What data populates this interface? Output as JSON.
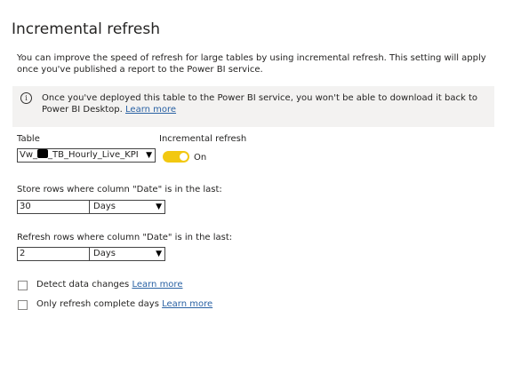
{
  "title": "Incremental refresh",
  "intro": "You can improve the speed of refresh for large tables by using incremental refresh. This setting will apply once you've published a report to the Power BI service.",
  "notice": {
    "icon": "info-icon",
    "text": "Once you've deployed this table to the Power BI service, you won't be able to download it back to Power BI Desktop.",
    "link": "Learn more"
  },
  "table": {
    "label": "Table",
    "prefix": "Vw_",
    "suffix": "_TB_Hourly_Live_KPI"
  },
  "incremental": {
    "label": "Incremental refresh",
    "state": "On",
    "color": "#f2c811"
  },
  "store": {
    "label": "Store rows where column \"Date\" is in the last:",
    "value": "30",
    "unit": "Days"
  },
  "refresh": {
    "label": "Refresh rows where column \"Date\" is in the last:",
    "value": "2",
    "unit": "Days"
  },
  "detect_changes": {
    "label": "Detect data changes",
    "link": "Learn more"
  },
  "complete_days": {
    "label": "Only refresh complete days",
    "link": "Learn more"
  }
}
